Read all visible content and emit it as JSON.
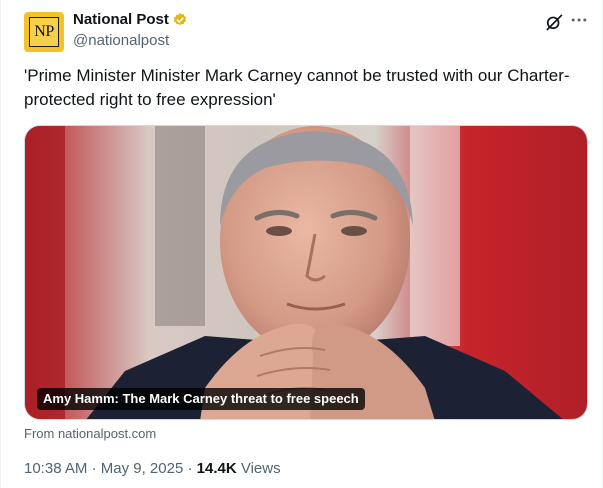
{
  "author": {
    "avatar_text": "NP",
    "display_name": "National Post",
    "handle": "@nationalpost",
    "verified_icon": "verified-gold-badge-icon"
  },
  "actions": {
    "grok_icon": "grok-icon",
    "more_icon": "more-horizontal-icon"
  },
  "tweet": {
    "text": "'Prime Minister Minister Mark Carney cannot be trusted with our Charter-protected right to free expression'"
  },
  "link_card": {
    "caption": "Amy Hamm: The Mark Carney threat to free speech",
    "source": "From nationalpost.com"
  },
  "meta": {
    "time": "10:38 AM",
    "separator": "·",
    "date": "May 9, 2025",
    "views_count": "14.4K",
    "views_label": "Views"
  },
  "colors": {
    "text_primary": "#0f1419",
    "text_secondary": "#536471",
    "verified_gold": "#e2b719",
    "brand_avatar": "#f3c22b"
  }
}
